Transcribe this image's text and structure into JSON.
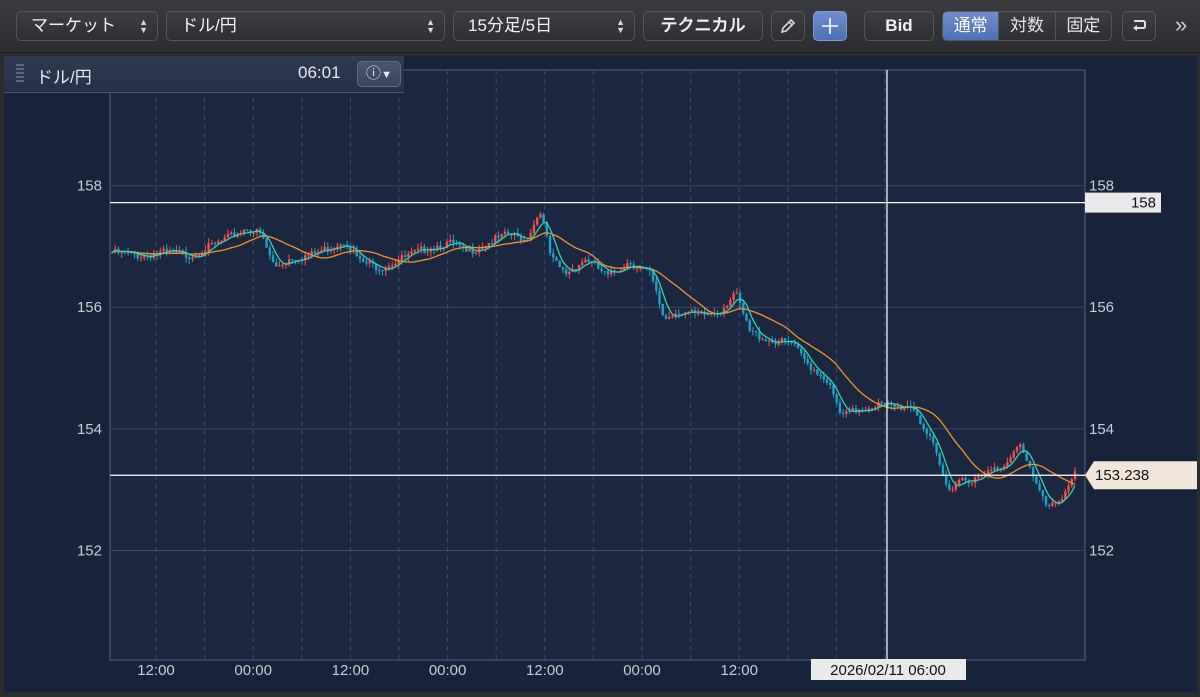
{
  "toolbar": {
    "market_select": "マーケット",
    "pair_select": "ドル/円",
    "period_select": "15分足/5日",
    "technical_button": "テクニカル",
    "bid_button": "Bid",
    "scale_modes": [
      "通常",
      "対数",
      "固定"
    ],
    "active_scale_mode": "通常"
  },
  "info_bar": {
    "symbol": "ドル/円",
    "time": "06:01"
  },
  "chart_data": {
    "type": "candlestick",
    "y_ticks": [
      "158",
      "156",
      "154",
      "152"
    ],
    "x_ticks": [
      "12:00",
      "00:00",
      "12:00",
      "00:00",
      "12:00",
      "00:00",
      "12:00",
      "00:00"
    ],
    "crosshair_price": "158",
    "crosshair_time": "2026/02/11 06:00",
    "last_price": "153.238",
    "ylim": [
      150.2,
      159.9
    ],
    "grid": true,
    "colors": {
      "up": "#ff4d4d",
      "down": "#21a0c8",
      "ma_short": "#34d2b0",
      "ma_long": "#f0942a"
    },
    "price_path": [
      [
        0,
        156.9
      ],
      [
        8,
        156.85
      ],
      [
        15,
        156.9
      ],
      [
        22,
        156.85
      ],
      [
        30,
        157.05
      ],
      [
        38,
        157.3
      ],
      [
        42,
        157.2
      ],
      [
        46,
        156.65
      ],
      [
        50,
        156.8
      ],
      [
        56,
        156.85
      ],
      [
        62,
        157.0
      ],
      [
        66,
        157.1
      ],
      [
        70,
        156.75
      ],
      [
        76,
        156.65
      ],
      [
        82,
        156.8
      ],
      [
        90,
        157.0
      ],
      [
        96,
        157.05
      ],
      [
        100,
        156.9
      ],
      [
        106,
        157.05
      ],
      [
        112,
        157.2
      ],
      [
        117,
        157.1
      ],
      [
        121,
        157.6
      ],
      [
        124,
        156.8
      ],
      [
        128,
        156.55
      ],
      [
        134,
        156.8
      ],
      [
        140,
        156.5
      ],
      [
        146,
        156.75
      ],
      [
        152,
        156.55
      ],
      [
        156,
        155.8
      ],
      [
        160,
        155.95
      ],
      [
        166,
        155.85
      ],
      [
        172,
        155.95
      ],
      [
        176,
        156.25
      ],
      [
        180,
        155.6
      ],
      [
        186,
        155.45
      ],
      [
        192,
        155.4
      ],
      [
        196,
        155.1
      ],
      [
        202,
        154.8
      ],
      [
        206,
        154.2
      ],
      [
        210,
        154.3
      ],
      [
        216,
        154.4
      ],
      [
        222,
        154.35
      ],
      [
        226,
        154.4
      ],
      [
        232,
        153.7
      ],
      [
        236,
        153.0
      ],
      [
        240,
        153.2
      ],
      [
        244,
        153.15
      ],
      [
        248,
        153.3
      ],
      [
        252,
        153.4
      ],
      [
        256,
        153.8
      ],
      [
        260,
        153.2
      ],
      [
        264,
        152.75
      ],
      [
        268,
        152.85
      ],
      [
        272,
        153.24
      ]
    ]
  }
}
